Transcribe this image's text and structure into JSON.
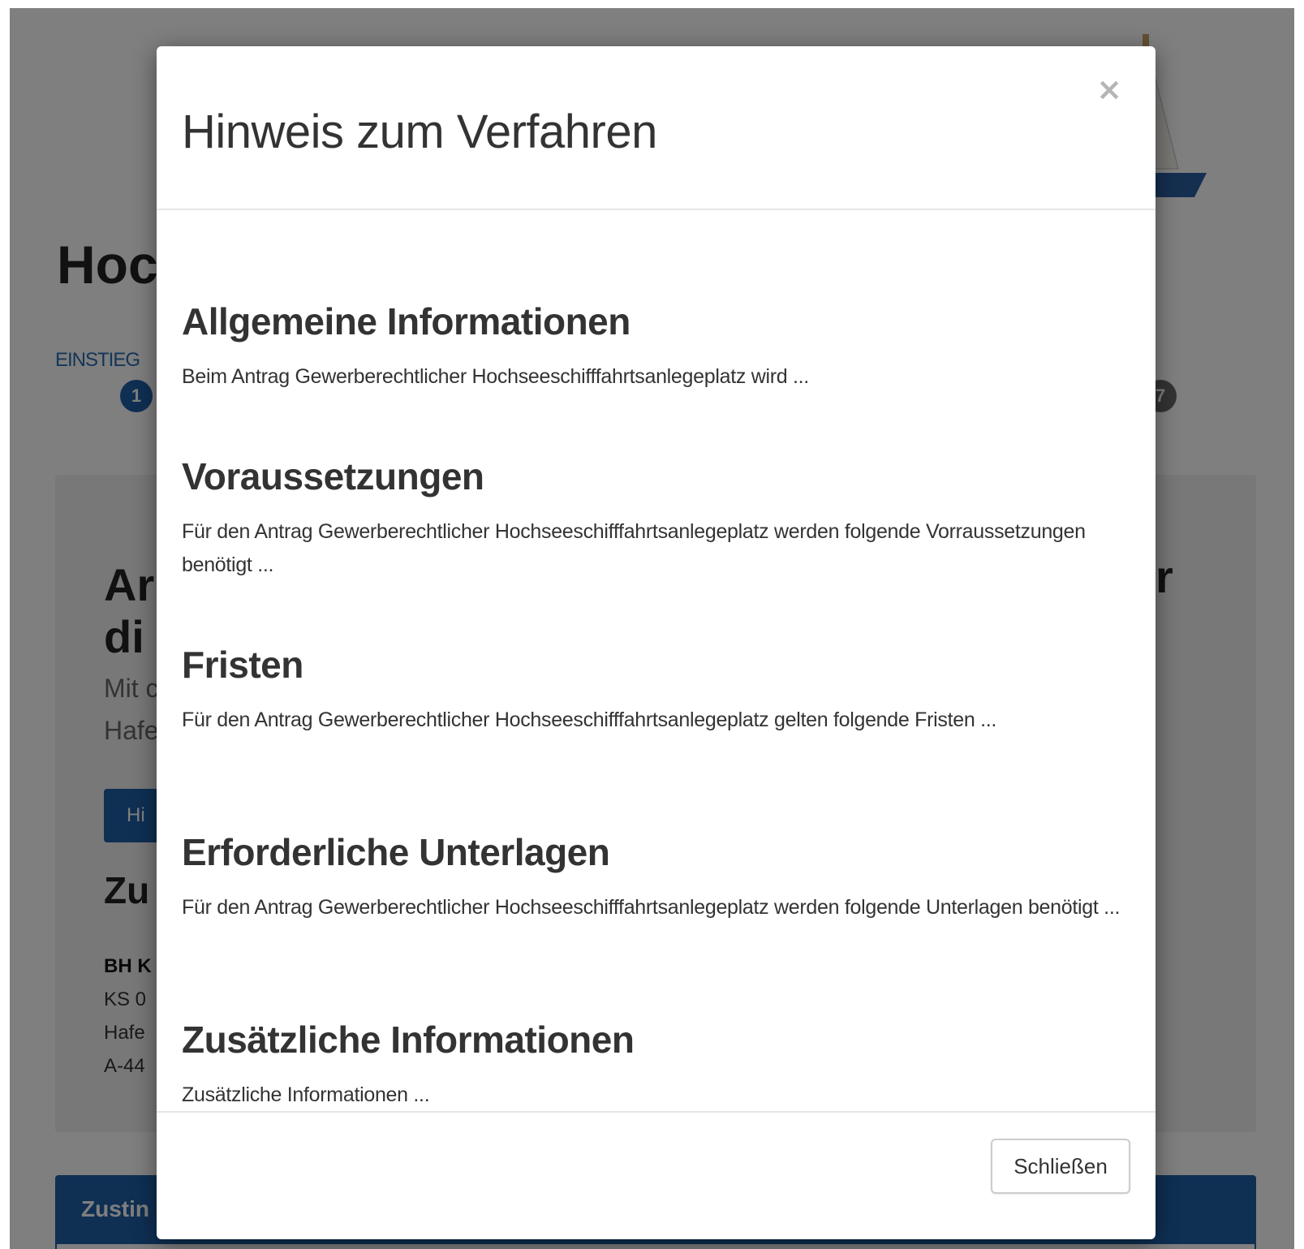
{
  "background_page": {
    "title_fragment": "Hoc",
    "steps_label_fragment": "EINSTIEG",
    "step_first": "1",
    "step_last": "7",
    "card": {
      "heading_line1": "Ar",
      "heading_line2": "di",
      "heading_tail": "r",
      "lead_line1": "Mit c",
      "lead_line2": "Hafe",
      "button_fragment": "Hi",
      "subheading_fragment": "Zu",
      "address_line1": "BH K",
      "address_line2": "KS 0",
      "address_line3": "Hafe",
      "address_line4": "A-44"
    },
    "panel_title_fragment": "Zustin"
  },
  "modal": {
    "title": "Hinweis zum Verfahren",
    "close_icon": "×",
    "sections": [
      {
        "heading": "Allgemeine Informationen",
        "text": "Beim Antrag Gewerberechtlicher Hochseeschifffahrtsanlegeplatz wird ..."
      },
      {
        "heading": "Voraussetzungen",
        "text": "Für den Antrag Gewerberechtlicher Hochseeschifffahrtsanlegeplatz werden folgende Vorraussetzungen benötigt ..."
      },
      {
        "heading": "Fristen",
        "text": "Für den Antrag Gewerberechtlicher Hochseeschifffahrtsanlegeplatz gelten folgende Fristen ..."
      },
      {
        "heading": "Erforderliche Unterlagen",
        "text": "Für den Antrag Gewerberechtlicher Hochseeschifffahrtsanlegeplatz werden folgende Unterlagen benötigt ..."
      },
      {
        "heading": "Zusätzliche Informationen",
        "text": "Zusätzliche Informationen ..."
      }
    ],
    "footer_button": "Schließen"
  },
  "colors": {
    "primary": "#1f5ea6",
    "backdrop": "rgba(0,0,0,0.5)"
  }
}
